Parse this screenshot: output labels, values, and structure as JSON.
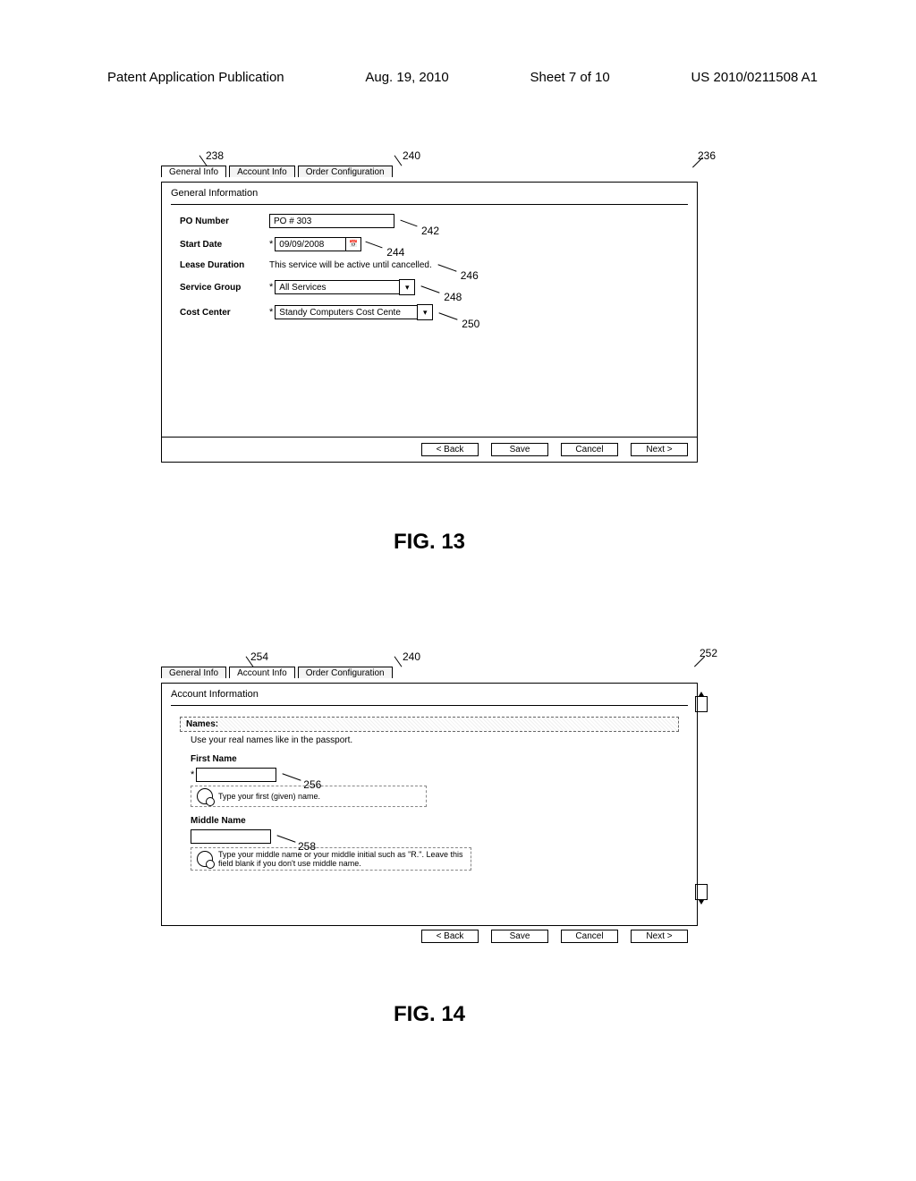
{
  "header": {
    "left": "Patent Application Publication",
    "date": "Aug. 19, 2010",
    "sheet": "Sheet 7 of 10",
    "pubno": "US 2010/0211508 A1"
  },
  "fig13": {
    "callouts": {
      "c236": "236",
      "c238": "238",
      "c240": "240",
      "c242": "242",
      "c244": "244",
      "c246": "246",
      "c248": "248",
      "c250": "250"
    },
    "tabs": {
      "general": "General Info",
      "account": "Account Info",
      "order": "Order Configuration"
    },
    "section_title": "General Information",
    "rows": {
      "po_label": "PO Number",
      "po_value": "PO # 303",
      "start_label": "Start Date",
      "start_value": "09/09/2008",
      "lease_label": "Lease Duration",
      "lease_text": "This service will be active until cancelled.",
      "service_label": "Service Group",
      "service_value": "All Services",
      "cost_label": "Cost Center",
      "cost_value": "Standy Computers Cost Cente"
    },
    "buttons": {
      "back": "< Back",
      "save": "Save",
      "cancel": "Cancel",
      "next": "Next >"
    },
    "asterisk": "*",
    "caption": "FIG. 13"
  },
  "fig14": {
    "callouts": {
      "c252": "252",
      "c254": "254",
      "c240": "240",
      "c256": "256",
      "c258": "258"
    },
    "tabs": {
      "general": "General Info",
      "account": "Account Info",
      "order": "Order Configuration"
    },
    "section_title": "Account Information",
    "names_bar": "Names:",
    "hint": "Use your real names like in the passport.",
    "first_label": "First Name",
    "first_tip": "Type your first (given) name.",
    "middle_label": "Middle Name",
    "middle_tip": "Type your middle name or your middle initial such as \"R.\". Leave this field blank if you don't use middle name.",
    "buttons": {
      "back": "< Back",
      "save": "Save",
      "cancel": "Cancel",
      "next": "Next >"
    },
    "asterisk": "*",
    "caption": "FIG. 14"
  }
}
